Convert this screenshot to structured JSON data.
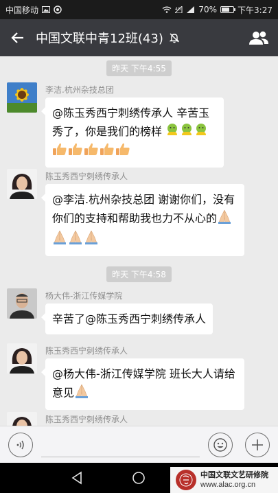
{
  "status_bar": {
    "carrier": "中国移动",
    "battery": "70%",
    "battery_level": 0.7,
    "time": "下午3:27"
  },
  "header": {
    "title": "中国文联中青12班(43)"
  },
  "chat": {
    "time_separators": [
      "昨天 下午4:55",
      "昨天 下午4:58"
    ],
    "messages": [
      {
        "sender": "李洁.杭州杂技总团",
        "text": "@陈玉秀西宁刺绣传承人 辛苦玉秀了，你是我们的榜样",
        "emoji": [
          "bless-emoji",
          "bless-emoji",
          "bless-emoji",
          "thumbs-up-emoji",
          "thumbs-up-emoji",
          "thumbs-up-emoji",
          "thumbs-up-emoji",
          "thumbs-up-emoji"
        ]
      },
      {
        "sender": "陈玉秀西宁刺绣传承人",
        "text": "@李洁.杭州杂技总团 谢谢你们，没有你们的支持和帮助我也力不从心的",
        "emoji": [
          "pray-emoji",
          "pray-emoji",
          "pray-emoji",
          "pray-emoji"
        ]
      },
      {
        "sender": "杨大伟-浙江传媒学院",
        "text": "辛苦了@陈玉秀西宁刺绣传承人"
      },
      {
        "sender": "陈玉秀西宁刺绣传承人",
        "text": "@杨大伟-浙江传媒学院 班长大人请给意见",
        "emoji": [
          "pray-emoji"
        ]
      },
      {
        "sender": "陈玉秀西宁刺绣传承人"
      }
    ]
  },
  "watermark": {
    "name": "中国文联文艺研修院",
    "url": "www.alac.org.cn"
  },
  "colors": {
    "status_bar_bg": "#1b1b1b",
    "title_bar_bg": "#393a3f",
    "chat_bg": "#ebebeb",
    "bubble_bg": "#ffffff",
    "seal_red": "#b8302a"
  }
}
